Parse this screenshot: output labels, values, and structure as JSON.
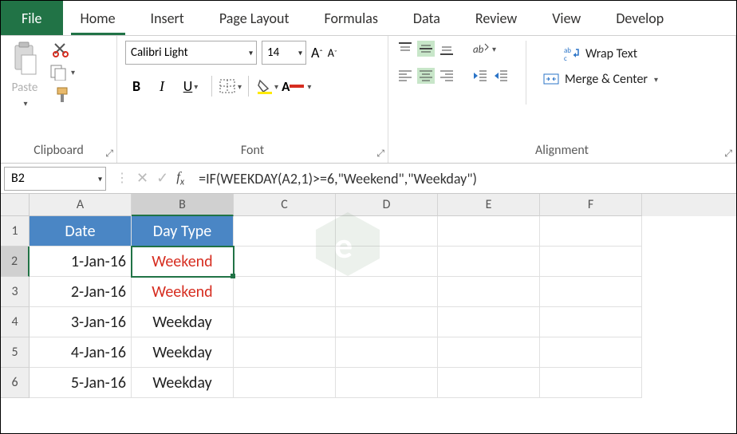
{
  "tabs": {
    "file": "File",
    "home": "Home",
    "insert": "Insert",
    "page_layout": "Page Layout",
    "formulas": "Formulas",
    "data": "Data",
    "review": "Review",
    "view": "View",
    "developer": "Develop"
  },
  "ribbon": {
    "clipboard": {
      "label": "Clipboard",
      "paste": "Paste"
    },
    "font": {
      "label": "Font",
      "name": "Calibri Light",
      "size": "14",
      "bold": "B",
      "italic": "I",
      "underline": "U"
    },
    "alignment": {
      "label": "Alignment",
      "wrap": "Wrap Text",
      "merge": "Merge & Center"
    }
  },
  "name_box": "B2",
  "formula": "=IF(WEEKDAY(A2,1)>=6,\"Weekend\",\"Weekday\")",
  "columns": [
    "A",
    "B",
    "C",
    "D",
    "E",
    "F"
  ],
  "col_sel_index": 1,
  "row_sel_index": 1,
  "rows": [
    {
      "num": "1",
      "a": "Date",
      "b": "Day Type",
      "header": true
    },
    {
      "num": "2",
      "a": "1-Jan-16",
      "b": "Weekend",
      "weekend": true,
      "active": true
    },
    {
      "num": "3",
      "a": "2-Jan-16",
      "b": "Weekend",
      "weekend": true
    },
    {
      "num": "4",
      "a": "3-Jan-16",
      "b": "Weekday"
    },
    {
      "num": "5",
      "a": "4-Jan-16",
      "b": "Weekday"
    },
    {
      "num": "6",
      "a": "5-Jan-16",
      "b": "Weekday"
    }
  ]
}
